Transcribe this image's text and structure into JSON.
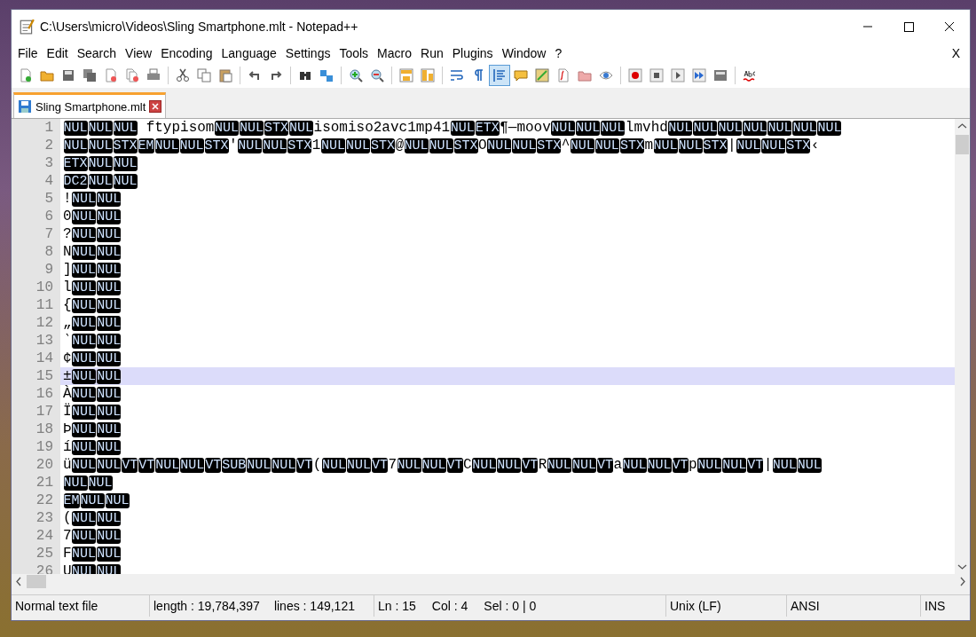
{
  "window": {
    "title": "C:\\Users\\micro\\Videos\\Sling Smartphone.mlt - Notepad++"
  },
  "menu": [
    "File",
    "Edit",
    "Search",
    "View",
    "Encoding",
    "Language",
    "Settings",
    "Tools",
    "Macro",
    "Run",
    "Plugins",
    "Window",
    "?"
  ],
  "menu_close": "X",
  "toolbar": [
    {
      "selected": false
    },
    {
      "selected": false
    },
    {
      "selected": false
    },
    {
      "selected": false
    },
    {
      "selected": false
    },
    {
      "selected": false
    },
    {
      "selected": false
    },
    {
      "selected": false
    },
    {
      "selected": false
    },
    {
      "selected": false
    },
    {
      "selected": false
    },
    {
      "selected": false
    },
    {
      "selected": false
    },
    {
      "selected": false
    },
    {
      "selected": false
    },
    {
      "selected": false
    },
    {
      "selected": false
    },
    {
      "selected": false
    },
    {
      "selected": false
    },
    {
      "selected": false
    },
    {
      "selected": true
    },
    {
      "selected": false
    },
    {
      "selected": false
    },
    {
      "selected": false
    },
    {
      "selected": false
    },
    {
      "selected": false
    },
    {
      "selected": false
    },
    {
      "selected": false
    },
    {
      "selected": false
    },
    {
      "selected": false
    },
    {
      "selected": false
    },
    {
      "selected": false
    }
  ],
  "tabs": [
    {
      "label": "Sling Smartphone.mlt",
      "selected": true
    }
  ],
  "lines": [
    {
      "number": "1",
      "current": false,
      "segments": [
        {
          "kind": "ctrl",
          "t": "NUL"
        },
        {
          "kind": "ctrl",
          "t": "NUL"
        },
        {
          "kind": "ctrl",
          "t": "NUL"
        },
        {
          "kind": "text",
          "t": " ftypisom"
        },
        {
          "kind": "ctrl",
          "t": "NUL"
        },
        {
          "kind": "ctrl",
          "t": "NUL"
        },
        {
          "kind": "ctrl",
          "t": "STX"
        },
        {
          "kind": "ctrl",
          "t": "NUL"
        },
        {
          "kind": "text",
          "t": "isomiso2avc1mp41"
        },
        {
          "kind": "ctrl",
          "t": "NUL"
        },
        {
          "kind": "ctrl",
          "t": "ETX"
        },
        {
          "kind": "text",
          "t": "¶—moov"
        },
        {
          "kind": "ctrl",
          "t": "NUL"
        },
        {
          "kind": "ctrl",
          "t": "NUL"
        },
        {
          "kind": "ctrl",
          "t": "NUL"
        },
        {
          "kind": "text",
          "t": "lmvhd"
        },
        {
          "kind": "ctrl",
          "t": "NUL"
        },
        {
          "kind": "ctrl",
          "t": "NUL"
        },
        {
          "kind": "ctrl",
          "t": "NUL"
        },
        {
          "kind": "ctrl",
          "t": "NUL"
        },
        {
          "kind": "ctrl",
          "t": "NUL"
        },
        {
          "kind": "ctrl",
          "t": "NUL"
        },
        {
          "kind": "ctrl",
          "t": "NUL"
        }
      ]
    },
    {
      "number": "2",
      "current": false,
      "segments": [
        {
          "kind": "ctrl",
          "t": "NUL"
        },
        {
          "kind": "ctrl",
          "t": "NUL"
        },
        {
          "kind": "ctrl",
          "t": "STX"
        },
        {
          "kind": "ctrl",
          "t": "EM"
        },
        {
          "kind": "ctrl",
          "t": "NUL"
        },
        {
          "kind": "ctrl",
          "t": "NUL"
        },
        {
          "kind": "ctrl",
          "t": "STX"
        },
        {
          "kind": "text",
          "t": "'"
        },
        {
          "kind": "ctrl",
          "t": "NUL"
        },
        {
          "kind": "ctrl",
          "t": "NUL"
        },
        {
          "kind": "ctrl",
          "t": "STX"
        },
        {
          "kind": "text",
          "t": "1"
        },
        {
          "kind": "ctrl",
          "t": "NUL"
        },
        {
          "kind": "ctrl",
          "t": "NUL"
        },
        {
          "kind": "ctrl",
          "t": "STX"
        },
        {
          "kind": "text",
          "t": "@"
        },
        {
          "kind": "ctrl",
          "t": "NUL"
        },
        {
          "kind": "ctrl",
          "t": "NUL"
        },
        {
          "kind": "ctrl",
          "t": "STX"
        },
        {
          "kind": "text",
          "t": "O"
        },
        {
          "kind": "ctrl",
          "t": "NUL"
        },
        {
          "kind": "ctrl",
          "t": "NUL"
        },
        {
          "kind": "ctrl",
          "t": "STX"
        },
        {
          "kind": "text",
          "t": "^"
        },
        {
          "kind": "ctrl",
          "t": "NUL"
        },
        {
          "kind": "ctrl",
          "t": "NUL"
        },
        {
          "kind": "ctrl",
          "t": "STX"
        },
        {
          "kind": "text",
          "t": "m"
        },
        {
          "kind": "ctrl",
          "t": "NUL"
        },
        {
          "kind": "ctrl",
          "t": "NUL"
        },
        {
          "kind": "ctrl",
          "t": "STX"
        },
        {
          "kind": "text",
          "t": "|"
        },
        {
          "kind": "ctrl",
          "t": "NUL"
        },
        {
          "kind": "ctrl",
          "t": "NUL"
        },
        {
          "kind": "ctrl",
          "t": "STX"
        },
        {
          "kind": "text",
          "t": "‹"
        }
      ]
    },
    {
      "number": "3",
      "current": false,
      "segments": [
        {
          "kind": "ctrl",
          "t": "ETX"
        },
        {
          "kind": "ctrl",
          "t": "NUL"
        },
        {
          "kind": "ctrl",
          "t": "NUL"
        }
      ]
    },
    {
      "number": "4",
      "current": false,
      "segments": [
        {
          "kind": "ctrl",
          "t": "DC2"
        },
        {
          "kind": "ctrl",
          "t": "NUL"
        },
        {
          "kind": "ctrl",
          "t": "NUL"
        }
      ]
    },
    {
      "number": "5",
      "current": false,
      "segments": [
        {
          "kind": "text",
          "t": "!"
        },
        {
          "kind": "ctrl",
          "t": "NUL"
        },
        {
          "kind": "ctrl",
          "t": "NUL"
        }
      ]
    },
    {
      "number": "6",
      "current": false,
      "segments": [
        {
          "kind": "text",
          "t": "0"
        },
        {
          "kind": "ctrl",
          "t": "NUL"
        },
        {
          "kind": "ctrl",
          "t": "NUL"
        }
      ]
    },
    {
      "number": "7",
      "current": false,
      "segments": [
        {
          "kind": "text",
          "t": "?"
        },
        {
          "kind": "ctrl",
          "t": "NUL"
        },
        {
          "kind": "ctrl",
          "t": "NUL"
        }
      ]
    },
    {
      "number": "8",
      "current": false,
      "segments": [
        {
          "kind": "text",
          "t": "N"
        },
        {
          "kind": "ctrl",
          "t": "NUL"
        },
        {
          "kind": "ctrl",
          "t": "NUL"
        }
      ]
    },
    {
      "number": "9",
      "current": false,
      "segments": [
        {
          "kind": "text",
          "t": "]"
        },
        {
          "kind": "ctrl",
          "t": "NUL"
        },
        {
          "kind": "ctrl",
          "t": "NUL"
        }
      ]
    },
    {
      "number": "10",
      "current": false,
      "segments": [
        {
          "kind": "text",
          "t": "l"
        },
        {
          "kind": "ctrl",
          "t": "NUL"
        },
        {
          "kind": "ctrl",
          "t": "NUL"
        }
      ]
    },
    {
      "number": "11",
      "current": false,
      "segments": [
        {
          "kind": "text",
          "t": "{"
        },
        {
          "kind": "ctrl",
          "t": "NUL"
        },
        {
          "kind": "ctrl",
          "t": "NUL"
        }
      ]
    },
    {
      "number": "12",
      "current": false,
      "segments": [
        {
          "kind": "text",
          "t": "„"
        },
        {
          "kind": "ctrl",
          "t": "NUL"
        },
        {
          "kind": "ctrl",
          "t": "NUL"
        }
      ]
    },
    {
      "number": "13",
      "current": false,
      "segments": [
        {
          "kind": "text",
          "t": "‵"
        },
        {
          "kind": "ctrl",
          "t": "NUL"
        },
        {
          "kind": "ctrl",
          "t": "NUL"
        }
      ]
    },
    {
      "number": "14",
      "current": false,
      "segments": [
        {
          "kind": "text",
          "t": "¢"
        },
        {
          "kind": "ctrl",
          "t": "NUL"
        },
        {
          "kind": "ctrl",
          "t": "NUL"
        }
      ]
    },
    {
      "number": "15",
      "current": true,
      "segments": [
        {
          "kind": "text",
          "t": "±"
        },
        {
          "kind": "ctrl",
          "t": "NUL"
        },
        {
          "kind": "ctrl",
          "t": "NUL"
        }
      ]
    },
    {
      "number": "16",
      "current": false,
      "segments": [
        {
          "kind": "text",
          "t": "À"
        },
        {
          "kind": "ctrl",
          "t": "NUL"
        },
        {
          "kind": "ctrl",
          "t": "NUL"
        }
      ]
    },
    {
      "number": "17",
      "current": false,
      "segments": [
        {
          "kind": "text",
          "t": "Ï"
        },
        {
          "kind": "ctrl",
          "t": "NUL"
        },
        {
          "kind": "ctrl",
          "t": "NUL"
        }
      ]
    },
    {
      "number": "18",
      "current": false,
      "segments": [
        {
          "kind": "text",
          "t": "Þ"
        },
        {
          "kind": "ctrl",
          "t": "NUL"
        },
        {
          "kind": "ctrl",
          "t": "NUL"
        }
      ]
    },
    {
      "number": "19",
      "current": false,
      "segments": [
        {
          "kind": "text",
          "t": "í"
        },
        {
          "kind": "ctrl",
          "t": "NUL"
        },
        {
          "kind": "ctrl",
          "t": "NUL"
        }
      ]
    },
    {
      "number": "20",
      "current": false,
      "segments": [
        {
          "kind": "text",
          "t": "ü"
        },
        {
          "kind": "ctrl",
          "t": "NUL"
        },
        {
          "kind": "ctrl",
          "t": "NUL"
        },
        {
          "kind": "ctrl",
          "t": "VT"
        },
        {
          "kind": "ctrl",
          "t": "VT"
        },
        {
          "kind": "ctrl",
          "t": "NUL"
        },
        {
          "kind": "ctrl",
          "t": "NUL"
        },
        {
          "kind": "ctrl",
          "t": "VT"
        },
        {
          "kind": "ctrl",
          "t": "SUB"
        },
        {
          "kind": "ctrl",
          "t": "NUL"
        },
        {
          "kind": "ctrl",
          "t": "NUL"
        },
        {
          "kind": "ctrl",
          "t": "VT"
        },
        {
          "kind": "text",
          "t": "("
        },
        {
          "kind": "ctrl",
          "t": "NUL"
        },
        {
          "kind": "ctrl",
          "t": "NUL"
        },
        {
          "kind": "ctrl",
          "t": "VT"
        },
        {
          "kind": "text",
          "t": "7"
        },
        {
          "kind": "ctrl",
          "t": "NUL"
        },
        {
          "kind": "ctrl",
          "t": "NUL"
        },
        {
          "kind": "ctrl",
          "t": "VT"
        },
        {
          "kind": "text",
          "t": "C"
        },
        {
          "kind": "ctrl",
          "t": "NUL"
        },
        {
          "kind": "ctrl",
          "t": "NUL"
        },
        {
          "kind": "ctrl",
          "t": "VT"
        },
        {
          "kind": "text",
          "t": "R"
        },
        {
          "kind": "ctrl",
          "t": "NUL"
        },
        {
          "kind": "ctrl",
          "t": "NUL"
        },
        {
          "kind": "ctrl",
          "t": "VT"
        },
        {
          "kind": "text",
          "t": "a"
        },
        {
          "kind": "ctrl",
          "t": "NUL"
        },
        {
          "kind": "ctrl",
          "t": "NUL"
        },
        {
          "kind": "ctrl",
          "t": "VT"
        },
        {
          "kind": "text",
          "t": "p"
        },
        {
          "kind": "ctrl",
          "t": "NUL"
        },
        {
          "kind": "ctrl",
          "t": "NUL"
        },
        {
          "kind": "ctrl",
          "t": "VT"
        },
        {
          "kind": "text",
          "t": "|"
        },
        {
          "kind": "ctrl",
          "t": "NUL"
        },
        {
          "kind": "ctrl",
          "t": "NUL"
        }
      ]
    },
    {
      "number": "21",
      "current": false,
      "segments": [
        {
          "kind": "ctrl",
          "t": "NUL"
        },
        {
          "kind": "ctrl",
          "t": "NUL"
        }
      ]
    },
    {
      "number": "22",
      "current": false,
      "segments": [
        {
          "kind": "ctrl",
          "t": "EM"
        },
        {
          "kind": "ctrl",
          "t": "NUL"
        },
        {
          "kind": "ctrl",
          "t": "NUL"
        }
      ]
    },
    {
      "number": "23",
      "current": false,
      "segments": [
        {
          "kind": "text",
          "t": "("
        },
        {
          "kind": "ctrl",
          "t": "NUL"
        },
        {
          "kind": "ctrl",
          "t": "NUL"
        }
      ]
    },
    {
      "number": "24",
      "current": false,
      "segments": [
        {
          "kind": "text",
          "t": "7"
        },
        {
          "kind": "ctrl",
          "t": "NUL"
        },
        {
          "kind": "ctrl",
          "t": "NUL"
        }
      ]
    },
    {
      "number": "25",
      "current": false,
      "segments": [
        {
          "kind": "text",
          "t": "F"
        },
        {
          "kind": "ctrl",
          "t": "NUL"
        },
        {
          "kind": "ctrl",
          "t": "NUL"
        }
      ]
    },
    {
      "number": "26",
      "current": false,
      "segments": [
        {
          "kind": "text",
          "t": "U"
        },
        {
          "kind": "ctrl",
          "t": "NUL"
        },
        {
          "kind": "ctrl",
          "t": "NUL"
        }
      ]
    }
  ],
  "status_bar": [
    [
      "Normal text file"
    ],
    [
      "length : 19,784,397",
      "lines : 149,121"
    ],
    [
      "Ln : 15",
      "Col : 4",
      "Sel : 0 | 0"
    ],
    [
      "Unix (LF)"
    ],
    [
      "ANSI"
    ],
    [
      "INS"
    ]
  ]
}
